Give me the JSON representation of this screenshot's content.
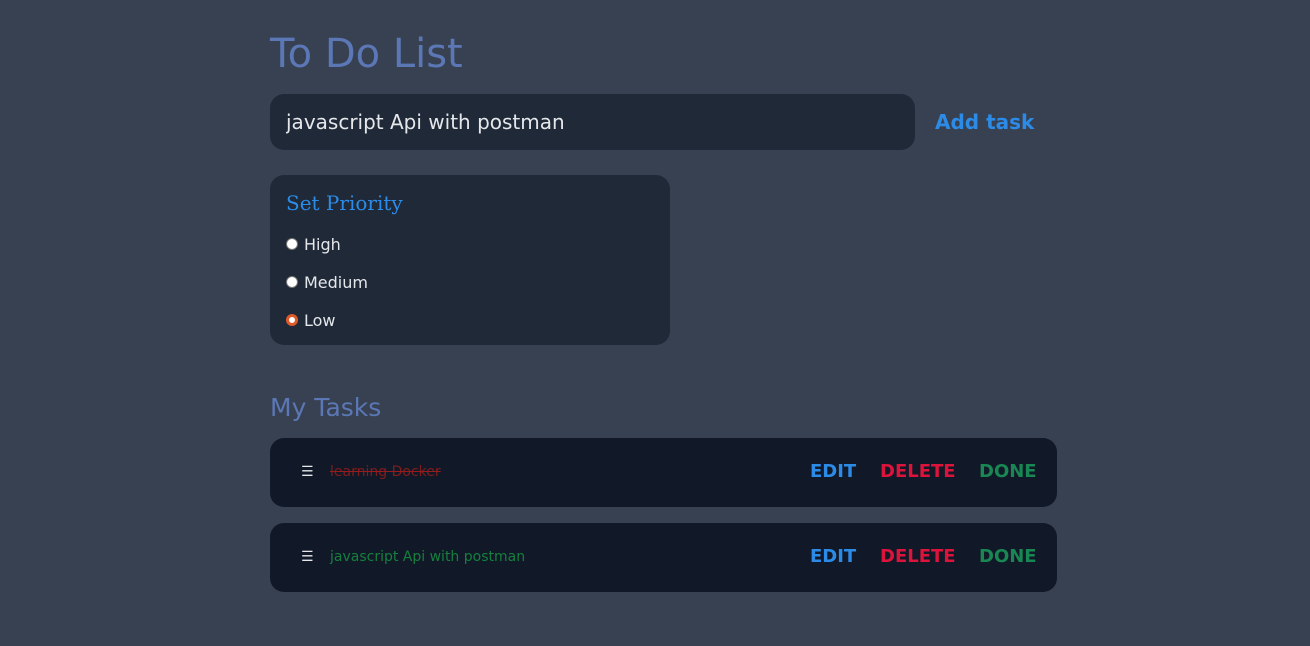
{
  "app": {
    "title": "To Do List"
  },
  "new_task": {
    "value": "javascript Api with postman",
    "add_label": "Add task"
  },
  "priority": {
    "title": "Set Priority",
    "options": [
      {
        "label": "High",
        "checked": false
      },
      {
        "label": "Medium",
        "checked": false
      },
      {
        "label": "Low",
        "checked": true
      }
    ]
  },
  "tasks_section": {
    "title": "My Tasks",
    "actions": {
      "edit": "EDIT",
      "delete": "DELETE",
      "done": "DONE"
    },
    "items": [
      {
        "handle": "☰",
        "text": "learning Docker ",
        "completed": true
      },
      {
        "handle": "☰",
        "text": "javascript Api with postman",
        "completed": false
      }
    ]
  },
  "colors": {
    "background": "#374151",
    "panel": "#1f2937",
    "task_row": "#111827",
    "heading": "#5b77b5",
    "accent_blue": "#2d8be8",
    "delete_red": "#dc143c",
    "done_green": "#198754"
  },
  "icons": {
    "drag_handle": "hamburger-icon"
  }
}
